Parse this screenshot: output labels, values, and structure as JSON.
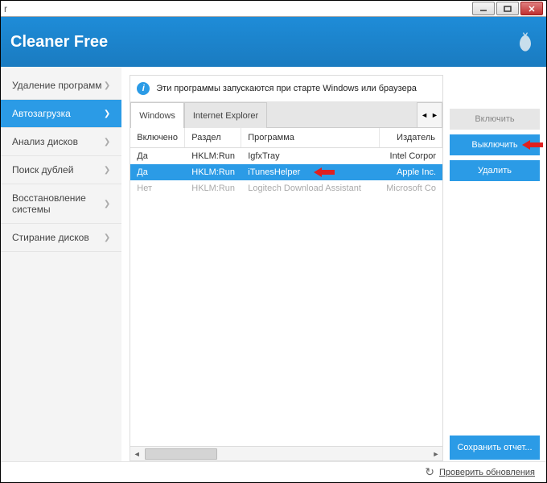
{
  "titlebar": {
    "left_text": "r"
  },
  "header": {
    "title": "Cleaner Free"
  },
  "sidebar": {
    "items": [
      {
        "label": "Удаление программ",
        "active": false
      },
      {
        "label": "Автозагрузка",
        "active": true
      },
      {
        "label": "Анализ дисков",
        "active": false
      },
      {
        "label": "Поиск дублей",
        "active": false
      },
      {
        "label": "Восстановление системы",
        "active": false
      },
      {
        "label": "Стирание дисков",
        "active": false
      }
    ]
  },
  "info_bar": {
    "text": "Эти программы запускаются при старте Windows или браузера"
  },
  "tabs": [
    {
      "label": "Windows",
      "active": true
    },
    {
      "label": "Internet Explorer",
      "active": false
    }
  ],
  "columns": {
    "enabled": "Включено",
    "section": "Раздел",
    "program": "Программа",
    "publisher": "Издатель"
  },
  "rows": [
    {
      "enabled": "Да",
      "section": "HKLM:Run",
      "program": "IgfxTray",
      "publisher": "Intel Corpor",
      "state": "normal"
    },
    {
      "enabled": "Да",
      "section": "HKLM:Run",
      "program": "iTunesHelper",
      "publisher": "Apple Inc.",
      "state": "selected"
    },
    {
      "enabled": "Нет",
      "section": "HKLM:Run",
      "program": "Logitech Download Assistant",
      "publisher": "Microsoft Co",
      "state": "disabled"
    }
  ],
  "actions": {
    "enable": "Включить",
    "disable": "Выключить",
    "delete": "Удалить",
    "save_report": "Сохранить отчет..."
  },
  "footer": {
    "check_updates": "Проверить обновления"
  }
}
